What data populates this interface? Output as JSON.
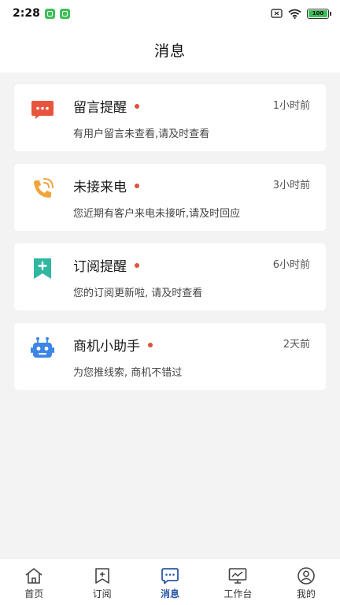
{
  "status_bar": {
    "time": "2:28",
    "battery": "100"
  },
  "header": {
    "title": "消息"
  },
  "messages": [
    {
      "icon": "chat-bubble-icon",
      "title": "留言提醒",
      "time": "1小时前",
      "desc": "有用户留言未查看,请及时查看",
      "unread": true
    },
    {
      "icon": "phone-missed-call-icon",
      "title": "未接来电",
      "time": "3小时前",
      "desc": "您近期有客户来电未接听,请及时回应",
      "unread": true
    },
    {
      "icon": "bookmark-plus-icon",
      "title": "订阅提醒",
      "time": "6小时前",
      "desc": "您的订阅更新啦, 请及时查看",
      "unread": true
    },
    {
      "icon": "robot-icon",
      "title": "商机小助手",
      "time": "2天前",
      "desc": "为您推线索, 商机不错过",
      "unread": true
    }
  ],
  "tab_bar": {
    "items": [
      {
        "label": "首页",
        "icon": "home-icon"
      },
      {
        "label": "订阅",
        "icon": "subscribe-icon"
      },
      {
        "label": "消息",
        "icon": "message-icon",
        "active": true
      },
      {
        "label": "工作台",
        "icon": "workbench-icon"
      },
      {
        "label": "我的",
        "icon": "profile-icon"
      }
    ]
  },
  "colors": {
    "accent": "#2a57a8",
    "unread_dot": "#e05238",
    "chat_icon": "#e8553f",
    "phone_icon": "#f0a43c",
    "bookmark_icon": "#2fb7a0",
    "robot_icon": "#3d86e6"
  }
}
